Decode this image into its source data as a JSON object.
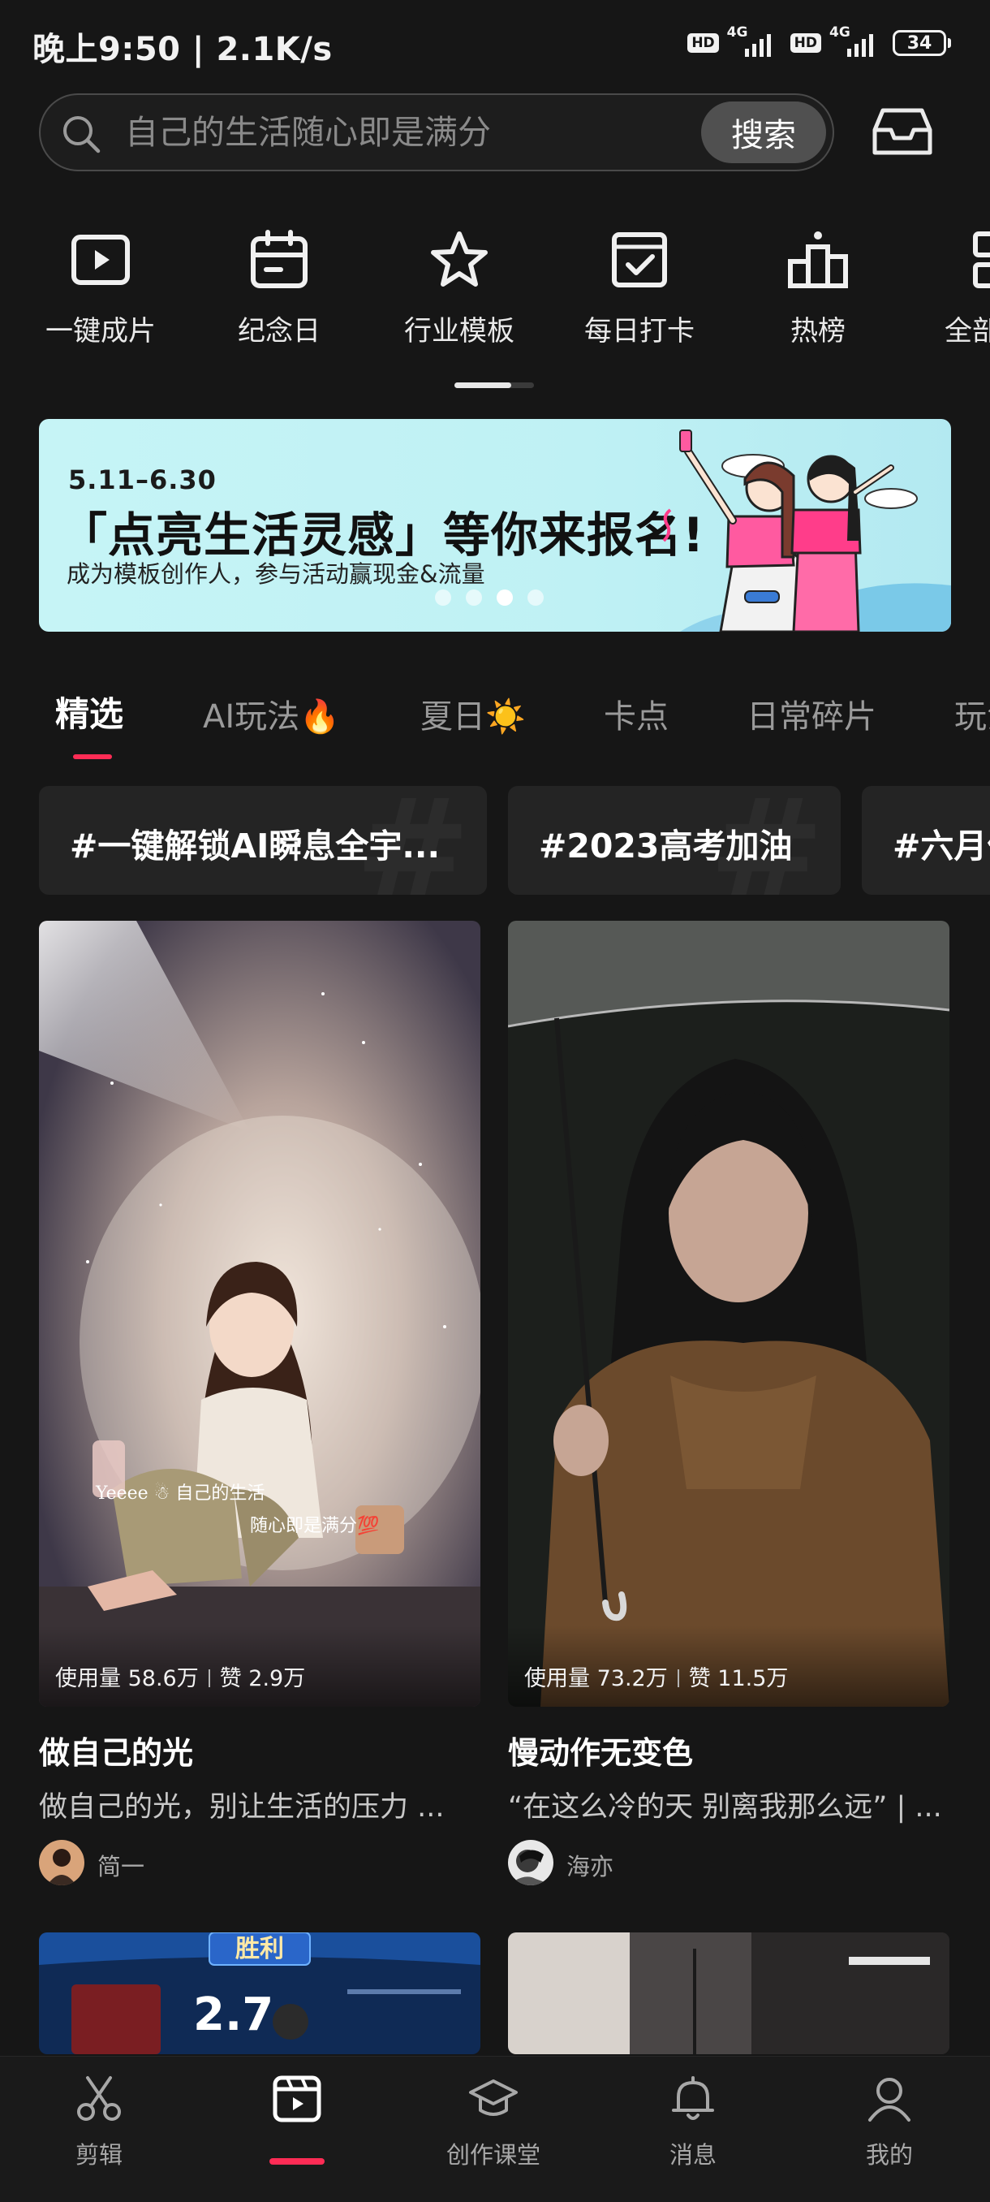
{
  "status_bar": {
    "time_speed": "晚上9:50 | 2.1K/s",
    "hd_label": "HD",
    "network_label": "4G",
    "battery": "34"
  },
  "search": {
    "placeholder": "自己的生活随心即是满分",
    "button_label": "搜索"
  },
  "inbox": {
    "icon": "inbox-icon"
  },
  "quick_actions": [
    {
      "label": "一键成片",
      "icon": "play-icon"
    },
    {
      "label": "纪念日",
      "icon": "calendar-icon"
    },
    {
      "label": "行业模板",
      "icon": "star-icon"
    },
    {
      "label": "每日打卡",
      "icon": "checkbox-icon"
    },
    {
      "label": "热榜",
      "icon": "podium-icon"
    },
    {
      "label": "全部",
      "icon": "grid-icon"
    }
  ],
  "banner": {
    "date": "5.11–6.30",
    "title": "「点亮生活灵感」等你来报名!",
    "subtitle": "成为模板创作人，参与活动赢现金&流量",
    "slide_count": 4,
    "active_slide": 3
  },
  "tabs": [
    {
      "label": "精选",
      "active": true
    },
    {
      "label": "AI玩法🔥"
    },
    {
      "label": "夏日☀️"
    },
    {
      "label": "卡点"
    },
    {
      "label": "日常碎片"
    },
    {
      "label": "玩法"
    }
  ],
  "hashtags": [
    "#一键解锁AI瞬息全宇...",
    "#2023高考加油",
    "#六月份"
  ],
  "cards": [
    {
      "usage": "使用量 58.6万",
      "likes": "赞 2.9万",
      "title": "做自己的光",
      "description": "做自己的光，别让生活的压力 ...",
      "author": "简一",
      "overlay_text_1": "Yeeee ☃ 自己的生活",
      "overlay_text_2": "随心即是满分💯"
    },
    {
      "usage": "使用量 73.2万",
      "likes": "赞 11.5万",
      "title": "慢动作无变色",
      "description": "“在这么冷的天 别离我那么远” | ...",
      "author": "海亦"
    }
  ],
  "row2_overlay": {
    "victory": "胜利",
    "score": "2.7"
  },
  "bottom_nav": [
    {
      "label": "剪辑",
      "icon": "scissors-icon"
    },
    {
      "label": "",
      "icon": "template-icon",
      "active": true
    },
    {
      "label": "创作课堂",
      "icon": "graduation-cap-icon"
    },
    {
      "label": "消息",
      "icon": "bell-icon"
    },
    {
      "label": "我的",
      "icon": "person-icon"
    }
  ],
  "colors": {
    "accent": "#fe2c55",
    "background": "#161616",
    "banner_bg": "#c6f4f6"
  }
}
